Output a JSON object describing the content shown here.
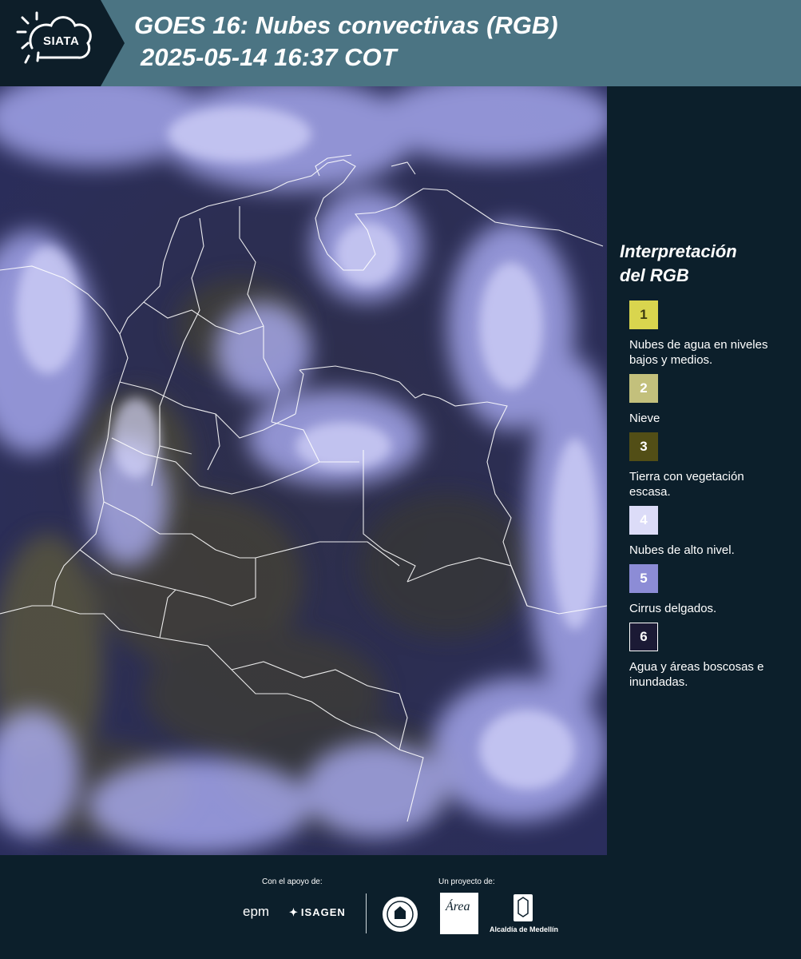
{
  "header": {
    "brand": "SIATA",
    "title_line1": "GOES 16: Nubes convectivas (RGB)",
    "title_line2": "2025-05-14 16:37 COT"
  },
  "map": {
    "description_icon": "satellite-rgb-composite",
    "boundary_color": "#ffffff"
  },
  "legend": {
    "title_line1": "Interpretación",
    "title_line2": "del RGB",
    "items": [
      {
        "number": "1",
        "label": "Nubes de agua en niveles bajos y medios.",
        "color": "#d9d54e",
        "text_color": "#3b3b10"
      },
      {
        "number": "2",
        "label": "Nieve",
        "color": "#c3c07c",
        "text_color": "#ffffff"
      },
      {
        "number": "3",
        "label": "Tierra con vegetación escasa.",
        "color": "#524e16",
        "text_color": "#ffffff"
      },
      {
        "number": "4",
        "label": "Nubes de alto nivel.",
        "color": "#dcdcf8",
        "text_color": "#ffffff"
      },
      {
        "number": "5",
        "label": "Cirrus delgados.",
        "color": "#8c8cd6",
        "text_color": "#ffffff"
      },
      {
        "number": "6",
        "label": "Agua y áreas boscosas e inundadas.",
        "color": "#1b1a35",
        "text_color": "#ffffff"
      }
    ]
  },
  "footer": {
    "support_caption": "Con el apoyo de:",
    "project_caption": "Un proyecto de:",
    "epm": "epm",
    "isagen": "ISAGEN",
    "area_logo": "Área",
    "alcaldia": "Alcaldía de Medellín"
  }
}
